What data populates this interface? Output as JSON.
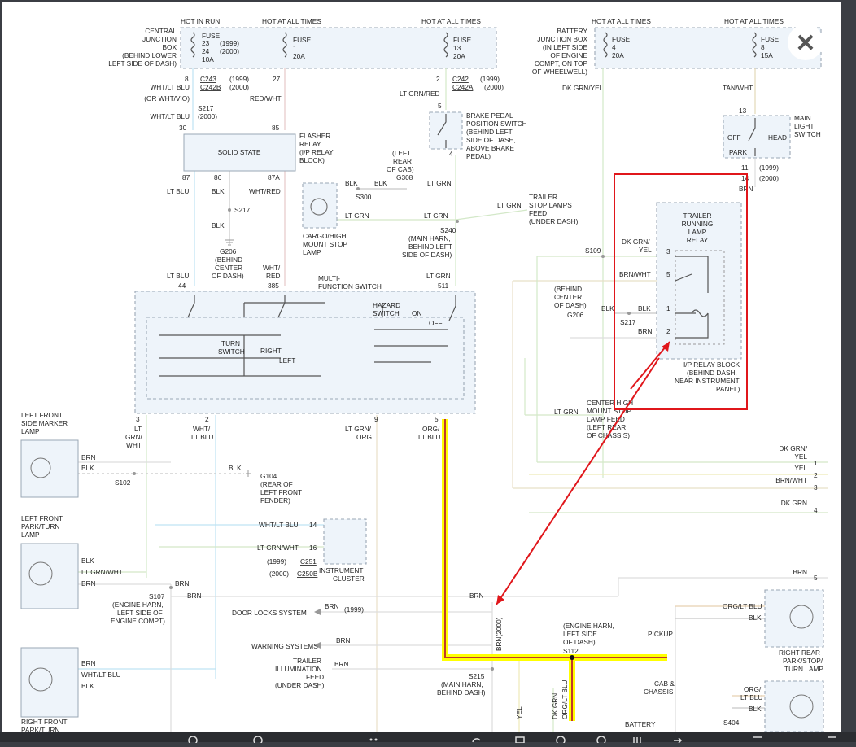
{
  "page": {
    "close_button_label": "✕"
  },
  "colors": {
    "background": "#ffffff",
    "highlight": "#ffff00",
    "highlight_core": "#c0392b",
    "annotation": "#e0161b"
  },
  "fuse_boxes": {
    "hot_in_run": "HOT IN RUN",
    "hot_at_all_times_1": "HOT AT ALL TIMES",
    "hot_at_all_times_2": "HOT AT ALL TIMES",
    "hot_at_all_times_3": "HOT AT ALL TIMES",
    "hot_at_all_times_4": "HOT AT ALL TIMES",
    "cjb_label": [
      "CENTRAL",
      "JUNCTION",
      "BOX",
      "(BEHIND LOWER",
      "LEFT SIDE OF DASH)"
    ],
    "fuse_a": [
      "FUSE",
      "23",
      "24",
      "10A"
    ],
    "fuse_a_years": [
      "(1999)",
      "(2000)"
    ],
    "fuse_b": [
      "FUSE",
      "1",
      "20A"
    ],
    "fuse_c": [
      "FUSE",
      "13",
      "20A"
    ],
    "bjb_label": [
      "BATTERY",
      "JUNCTION BOX",
      "(IN LEFT SIDE",
      "OF ENGINE",
      "COMPT, ON TOP",
      "OF WHEELWELL)"
    ],
    "fuse_d": [
      "FUSE",
      "4",
      "20A"
    ],
    "fuse_e": [
      "FUSE",
      "8",
      "15A"
    ]
  },
  "upper_left": {
    "pin8": "8",
    "c243": "C243",
    "c242b": "C242B",
    "y1999": "(1999)",
    "y2000": "(2000)",
    "pin27": "27",
    "pin2": "2",
    "c242": "C242",
    "c242a": "C242A",
    "y1999b": "(1999)",
    "y2000b": "(2000)",
    "wht_ltblu": "WHT/LT BLU",
    "or_wht_vio": "(OR WHT/VIO)",
    "s217": "S217",
    "wht_ltblu2": "WHT/LT BLU",
    "y2000c": "(2000)",
    "red_wht": "RED/WHT",
    "ltgrn_red": "LT GRN/RED",
    "pin30": "30",
    "pin85": "85",
    "solid_state": "SOLID STATE",
    "flasher_relay": [
      "FLASHER",
      "RELAY",
      "(I/P RELAY",
      "BLOCK)"
    ],
    "pin87": "87",
    "pin86": "86",
    "pin87a": "87A",
    "lt_blu": "LT BLU",
    "blk": "BLK",
    "wht_red": "WHT/RED",
    "s217b": "S217",
    "blk2": "BLK",
    "g206": [
      "G206",
      "(BEHIND",
      "CENTER",
      "OF DASH)"
    ],
    "lt_blu2": "LT BLU",
    "pin44": "44",
    "wht_red2": [
      "WHT/",
      "RED"
    ],
    "pin385": "385"
  },
  "brake": {
    "pin5": "5",
    "pin4": "4",
    "label": [
      "BRAKE PEDAL",
      "POSITION SWITCH",
      "(BEHIND LEFT",
      "SIDE OF DASH,",
      "ABOVE BRAKE",
      "PEDAL)"
    ],
    "lt_grn": "LT GRN",
    "lt_grn2": "LT GRN",
    "lt_grn3": "LT GRN",
    "lt_grn4": "LT GRN",
    "lt_grn5": "LT GRN",
    "lt_grn6": "LT GRN",
    "pin511": "511",
    "s240": [
      "S240",
      "(MAIN HARN,",
      "BEHIND LEFT",
      "SIDE OF DASH)"
    ],
    "trailer_feed": [
      "TRAILER",
      "STOP LAMPS",
      "FEED",
      "(UNDER DASH)"
    ],
    "g308": [
      "(LEFT",
      "REAR",
      "OF CAB)",
      "G308"
    ],
    "blk": "BLK",
    "blk2": "BLK",
    "s300": "S300",
    "cargo": [
      "CARGO/HIGH",
      "MOUNT STOP",
      "LAMP"
    ]
  },
  "mfs": {
    "title": [
      "MULTI-",
      "FUNCTION SWITCH"
    ],
    "hazard": [
      "HAZARD",
      "SWITCH"
    ],
    "on": "ON",
    "off": "OFF",
    "turn": [
      "TURN",
      "SWITCH"
    ],
    "right": "RIGHT",
    "left": "LEFT",
    "pin3": "3",
    "pin2": "2",
    "pin9": "9",
    "pin5": "5",
    "w3": [
      "LT",
      "GRN/",
      "WHT"
    ],
    "w2": [
      "WHT/",
      "LT BLU"
    ],
    "w9": [
      "LT GRN/",
      "ORG"
    ],
    "w5": [
      "ORG/",
      "LT BLU"
    ]
  },
  "right_side": {
    "dkgrn_yel": "DK GRN/YEL",
    "tan_wht": "TAN/WHT",
    "pin13": "13",
    "headlight": [
      "MAIN",
      "LIGHT",
      "SWITCH"
    ],
    "off": "OFF",
    "park": "PARK",
    "head": "HEAD",
    "pin11": "11",
    "pin14": "14",
    "y1999": "(1999)",
    "y2000": "(2000)",
    "brn": "BRN",
    "relay": [
      "TRAILER",
      "RUNNING",
      "LAMP",
      "RELAY"
    ],
    "dkgrn_yel2": [
      "DK GRN/",
      "YEL"
    ],
    "brn_wht": "BRN/WHT",
    "blk": "BLK",
    "blk2": "BLK",
    "brn2": "BRN",
    "r3": "3",
    "r5": "5",
    "r1": "1",
    "r2": "2",
    "s109": "S109",
    "s217": "S217",
    "g206": "G206",
    "behind": [
      "(BEHIND",
      "CENTER",
      "OF DASH)"
    ],
    "ip_block": [
      "I/P RELAY BLOCK",
      "(BEHIND DASH,",
      "NEAR INSTRUMENT",
      "PANEL)"
    ],
    "lt_grn": "LT GRN",
    "chmsl": [
      "CENTER HIGH",
      "MOUNT STOP",
      "LAMP FEED",
      "(LEFT REAR",
      "OF CHASSIS)"
    ],
    "c1": [
      "DK GRN/",
      "YEL"
    ],
    "c1n": "1",
    "c2": "YEL",
    "c2n": "2",
    "c3": "BRN/WHT",
    "c3n": "3",
    "c4": "DK GRN",
    "c4n": "4",
    "c5": "BRN",
    "c5n": "5"
  },
  "lower_left": {
    "lfsm": [
      "LEFT FRONT",
      "SIDE MARKER",
      "LAMP"
    ],
    "brn": "BRN",
    "blk": "BLK",
    "s102": "S102",
    "blk_g": "BLK",
    "g104": [
      "G104",
      "(REAR OF",
      "LEFT FRONT",
      "FENDER)"
    ],
    "lfpt": [
      "LEFT FRONT",
      "PARK/TURN",
      "LAMP"
    ],
    "blk2": "BLK",
    "ltgrn_wht": "LT GRN/WHT",
    "brn2": "BRN",
    "wht_ltblu": "WHT/LT BLU",
    "pin14": "14",
    "ltgrn_wht2": "LT GRN/WHT",
    "pin16": "16",
    "y1999": "(1999)",
    "c251": "C251",
    "y2000": "(2000)",
    "c250b": "C250B",
    "ic": [
      "INSTRUMENT",
      "CLUSTER"
    ],
    "s107": [
      "S107",
      "(ENGINE HARN,",
      "LEFT SIDE OF",
      "ENGINE COMPT)"
    ],
    "brn3": "BRN",
    "brn4": "BRN",
    "rfpt": [
      "RIGHT FRONT",
      "PARK/TURN"
    ],
    "brn5": "BRN",
    "wht_ltblu2": "WHT/LT BLU",
    "blk3": "BLK"
  },
  "lower_mid": {
    "door_locks": "DOOR LOCKS SYSTEM",
    "brn_dl": "BRN",
    "y1999": "(1999)",
    "brn_top": "BRN",
    "warning": "WARNING SYSTEMS",
    "brn_ws": "BRN",
    "trailer_ill": [
      "TRAILER",
      "ILLUMINATION",
      "FEED",
      "(UNDER DASH)"
    ],
    "brn_ti": "BRN",
    "brn2000": "BRN(2000)",
    "s215": [
      "S215",
      "(MAIN HARN,",
      "BEHIND DASH)"
    ],
    "s112": [
      "(ENGINE HARN,",
      "LEFT SIDE",
      "OF DASH)",
      "S112"
    ],
    "yel": "YEL",
    "dkgrn": "DK GRN",
    "org_ltblu": "ORG/LT BLU",
    "battery": "BATTERY"
  },
  "lower_right": {
    "pickup": "PICKUP",
    "cab_chassis": [
      "CAB &",
      "CHASSIS"
    ],
    "org_ltblu": "ORG/LT BLU",
    "blk": "BLK",
    "rrl": [
      "RIGHT REAR",
      "PARK/STOP/",
      "TURN LAMP"
    ],
    "org_ltblu2": [
      "ORG/",
      "LT BLU"
    ],
    "blk2": "BLK",
    "s404": "S404"
  }
}
